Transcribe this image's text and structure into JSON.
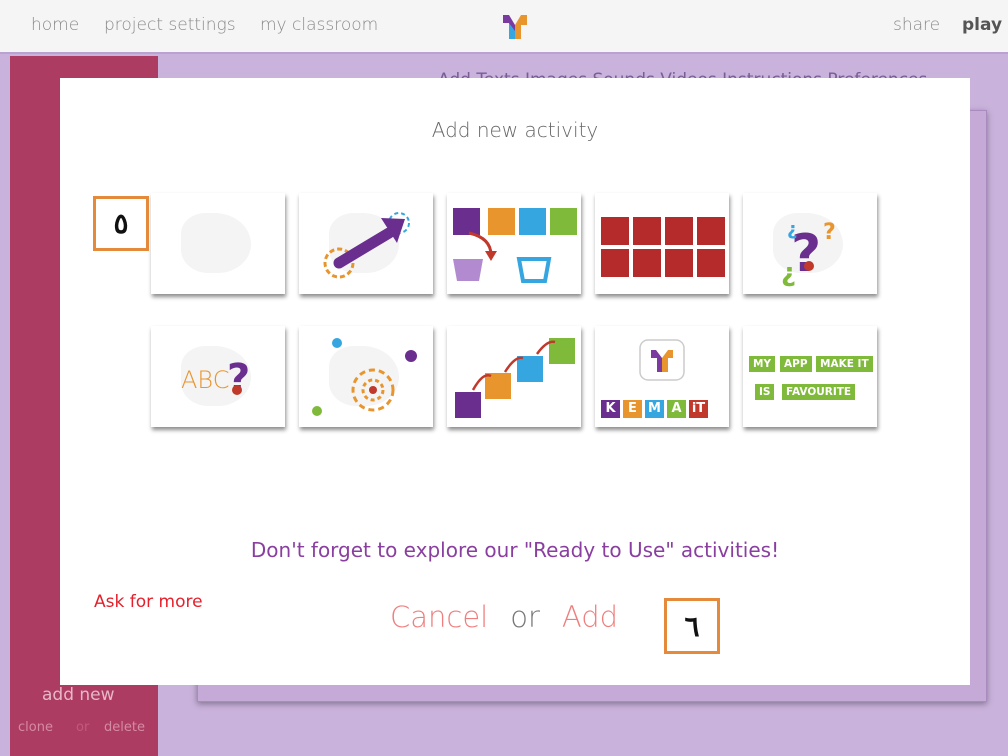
{
  "topbar": {
    "home": "home",
    "project_settings": "project settings",
    "my_classroom": "my classroom",
    "share": "share",
    "play": "play"
  },
  "left_panel": {
    "add_new": "add new",
    "clone": "clone",
    "or": "or",
    "delete": "delete"
  },
  "background_tabs": "Add   Texts   Images   Sounds   Videos   Instructions   Preferences",
  "modal": {
    "title": "Add new activity",
    "tiles_row1": [
      "blank-activity",
      "pointing-activity",
      "sorting-activity",
      "memory-activity",
      "question-activity"
    ],
    "tiles_row2": [
      "letters-question-activity",
      "target-activity",
      "sequence-activity",
      "kemait-activity",
      "sentence-builder-activity"
    ],
    "tile_texts": {
      "abc": "ABC",
      "kemait": [
        "K",
        "E",
        "M",
        "A",
        "iT"
      ],
      "fav": [
        "MY",
        "APP",
        "MAKE IT",
        "IS",
        "FAVOURITE"
      ]
    },
    "explore": "Don't forget to explore our \"Ready to Use\" activities!",
    "ask_more": "Ask for more",
    "cancel": "Cancel",
    "or": "or",
    "add": "Add"
  },
  "annotations": {
    "badge_5": "٥",
    "badge_6": "٦"
  },
  "colors": {
    "accent_purple": "#6a2e8f",
    "orange": "#e8952e",
    "blue": "#36a6e0",
    "green": "#7fba3a",
    "red": "#b52a2a",
    "cancel": "#ef7f7f"
  }
}
